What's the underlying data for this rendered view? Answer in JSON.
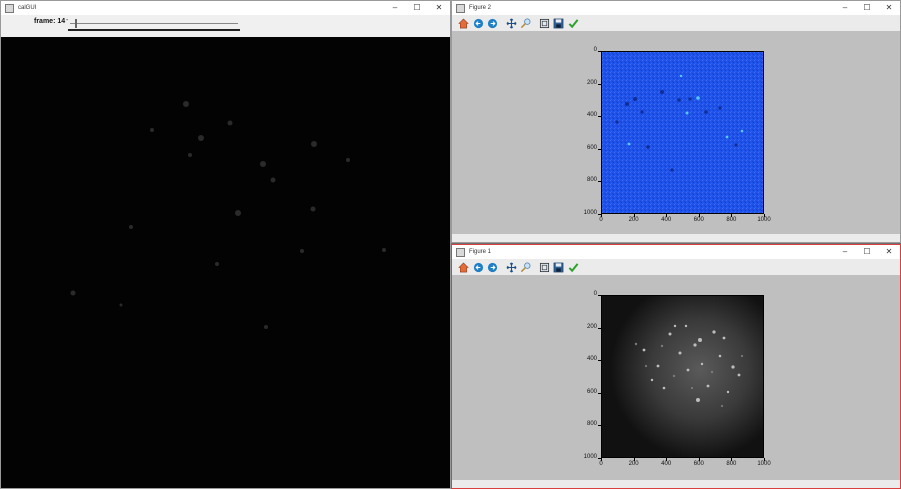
{
  "calgui": {
    "title": "calGUI",
    "frame_label": "frame: 14",
    "slider_min_label": "-"
  },
  "figure2": {
    "title": "Figure 2",
    "toolbar": [
      "home-icon",
      "back-arrow-icon",
      "forward-arrow-icon",
      "pan-icon",
      "zoom-icon",
      "subplots-icon",
      "save-icon",
      "check-icon"
    ],
    "y_ticks": [
      "0",
      "200",
      "400",
      "600",
      "800",
      "1000"
    ],
    "x_ticks": [
      "0",
      "200",
      "400",
      "600",
      "800",
      "1000"
    ],
    "colormap_color": "#1e4fe6"
  },
  "figure1": {
    "title": "Figure 1",
    "toolbar": [
      "home-icon",
      "back-arrow-icon",
      "forward-arrow-icon",
      "pan-icon",
      "zoom-icon",
      "subplots-icon",
      "save-icon",
      "check-icon"
    ],
    "y_ticks": [
      "0",
      "200",
      "400",
      "600",
      "800",
      "1000"
    ],
    "x_ticks": [
      "0",
      "200",
      "400",
      "600",
      "800",
      "1000"
    ],
    "colormap_color": "#2a2a2a"
  },
  "window_controls": {
    "minimize": "–",
    "maximize": "☐",
    "close": "✕"
  }
}
